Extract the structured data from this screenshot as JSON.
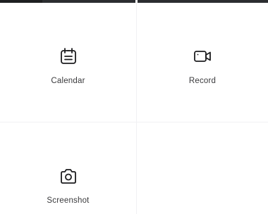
{
  "top_bar": {
    "color": "#2b2d30"
  },
  "tiles": [
    {
      "label": "Calendar",
      "icon": "calendar-icon"
    },
    {
      "label": "Record",
      "icon": "video-camera-icon"
    },
    {
      "label": "Screenshot",
      "icon": "camera-icon"
    }
  ],
  "colors": {
    "icon": "#1c1c1e",
    "label": "#3a3a3c",
    "divider": "#f1f1f3",
    "background": "#ffffff"
  }
}
